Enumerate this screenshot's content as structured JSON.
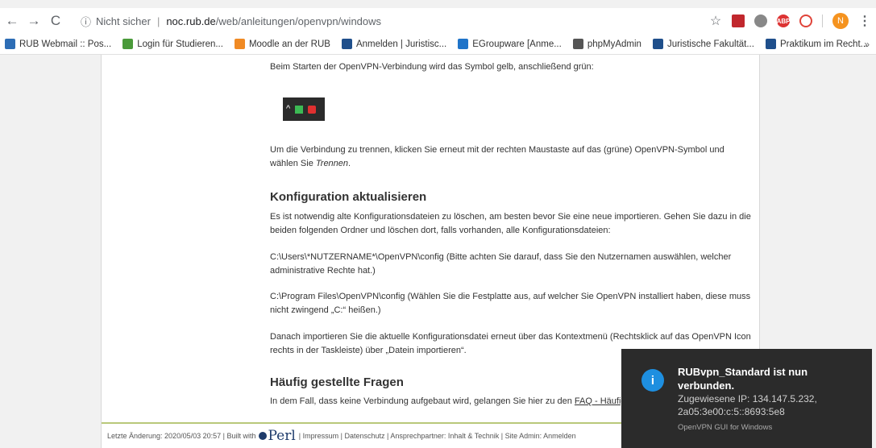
{
  "browser": {
    "nav": {
      "back": "←",
      "forward": "→",
      "reload": "C"
    },
    "omnibox": {
      "security_label": "Nicht sicher",
      "host": "noc.rub.de",
      "path": "/web/anleitungen/openvpn/windows"
    },
    "extensions": [
      "ABP",
      "N"
    ],
    "menu": "⋮",
    "bookmarks": [
      {
        "label": "RUB Webmail :: Pos...",
        "color": "#2d6db5"
      },
      {
        "label": "Login für Studieren...",
        "color": "#4a9a3a"
      },
      {
        "label": "Moodle an der RUB",
        "color": "#f08a24"
      },
      {
        "label": "Anmelden | Juristisc...",
        "color": "#1f4f8b"
      },
      {
        "label": "EGroupware [Anme...",
        "color": "#1f74c9"
      },
      {
        "label": "phpMyAdmin",
        "color": "#555555"
      },
      {
        "label": "Juristische Fakultät...",
        "color": "#1f4f8b"
      },
      {
        "label": "Praktikum im Recht...",
        "color": "#1f4f8b"
      }
    ],
    "bookmarks_more": "»"
  },
  "page": {
    "p1": "Beim Starten der OpenVPN-Verbindung wird das Symbol gelb, anschließend grün:",
    "tray_caret": "^",
    "p2": "Um die Verbindung zu trennen, klicken Sie erneut mit der rechten Maustaste auf das (grüne) OpenVPN-Symbol und wählen Sie ",
    "p2_em": "Trennen",
    "p2_end": ".",
    "h_config": "Konfiguration aktualisieren",
    "p3": "Es ist notwendig alte Konfigurationsdateien zu löschen, am besten bevor Sie eine neue importieren. Gehen Sie dazu in die beiden folgenden Ordner und löschen dort, falls vorhanden, alle Konfigurationsdateien:",
    "p4": "C:\\Users\\*NUTZERNAME*\\OpenVPN\\config (Bitte achten Sie darauf, dass Sie den Nutzernamen auswählen, welcher administrative Rechte hat.)",
    "p5": "C:\\Program Files\\OpenVPN\\config (Wählen Sie die Festplatte aus, auf welcher Sie OpenVPN installiert haben, diese muss nicht zwingend „C:“ heißen.)",
    "p6": "Danach importieren Sie die aktuelle Konfigurationsdatei erneut über das Kontextmenü (Rechtsklick auf das OpenVPN Icon rechts in der Taskleiste) über „Datein importieren“.",
    "h_faq": "Häufig gestellte Fragen",
    "p7": "In dem Fall, dass keine Verbindung aufgebaut wird, gelangen Sie hier zu den ",
    "faq_link": "FAQ - Häufig g",
    "footer": {
      "changed": "Letzte Änderung: 2020/05/03 20:57 | Built with",
      "perl": "Perl",
      "links": "| Impressum | Datenschutz | Ansprechpartner: Inhalt & Technik | Site Admin: Anmelden"
    }
  },
  "notification": {
    "icon": "i",
    "title": "RUBvpn_Standard ist nun verbunden.",
    "body": "Zugewiesene IP: 134.147.5.232, 2a05:3e00:c:5::8693:5e8",
    "app": "OpenVPN GUI for Windows"
  }
}
